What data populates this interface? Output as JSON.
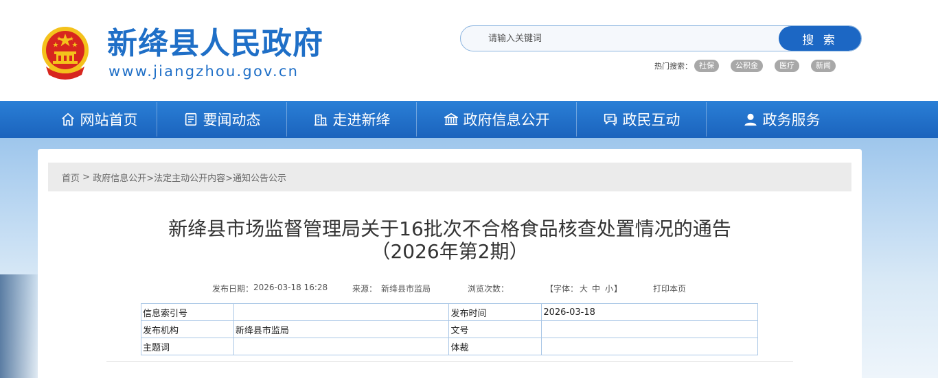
{
  "header": {
    "site_title": "新绛县人民政府",
    "site_url": "www.jiangzhou.gov.cn",
    "search": {
      "placeholder": "请输入关键词",
      "button_label": "搜 索"
    },
    "hot_search": {
      "label": "热门搜索：",
      "tags": [
        "社保",
        "公积金",
        "医疗",
        "新闻"
      ]
    }
  },
  "nav": {
    "items": [
      {
        "label": "网站首页",
        "icon": "home-icon"
      },
      {
        "label": "要闻动态",
        "icon": "news-icon"
      },
      {
        "label": "走进新绛",
        "icon": "building-icon"
      },
      {
        "label": "政府信息公开",
        "icon": "government-icon"
      },
      {
        "label": "政民互动",
        "icon": "chat-icon"
      },
      {
        "label": "政务服务",
        "icon": "user-icon"
      }
    ]
  },
  "breadcrumb": {
    "home": "首页",
    "sep": " > ",
    "level1": "政府信息公开",
    "level2": ">法定主动公开内容",
    "level3": ">通知公告公示"
  },
  "article": {
    "title_line1": "新绛县市场监督管理局关于16批次不合格食品核查处置情况的通告",
    "title_line2": "（2026年第2期）"
  },
  "meta": {
    "publish_date_label": "发布日期：",
    "publish_date_value": "2026-03-18 16:28",
    "source_label": "来源：",
    "source_value": "新绛县市监局",
    "views_label": "浏览次数：",
    "font_label": "【字体：",
    "font_large": "大",
    "font_medium": "中",
    "font_small": "小",
    "font_close": "】",
    "print_label": "打印本页"
  },
  "info_table": {
    "rows": [
      {
        "label1": "信息索引号",
        "value1": "",
        "label2": "发布时间",
        "value2": "2026-03-18"
      },
      {
        "label1": "发布机构",
        "value1": "新绛县市监局",
        "label2": "文号",
        "value2": ""
      },
      {
        "label1": "主题词",
        "value1": "",
        "label2": "体裁",
        "value2": ""
      }
    ]
  },
  "colors": {
    "brand_blue": "#1f6fc7",
    "nav_blue": "#1b63bd",
    "search_button": "#1c67c4",
    "hot_tag": "#a8a8a8",
    "emblem_red": "#d7261e",
    "emblem_gold": "#f4c21c"
  }
}
